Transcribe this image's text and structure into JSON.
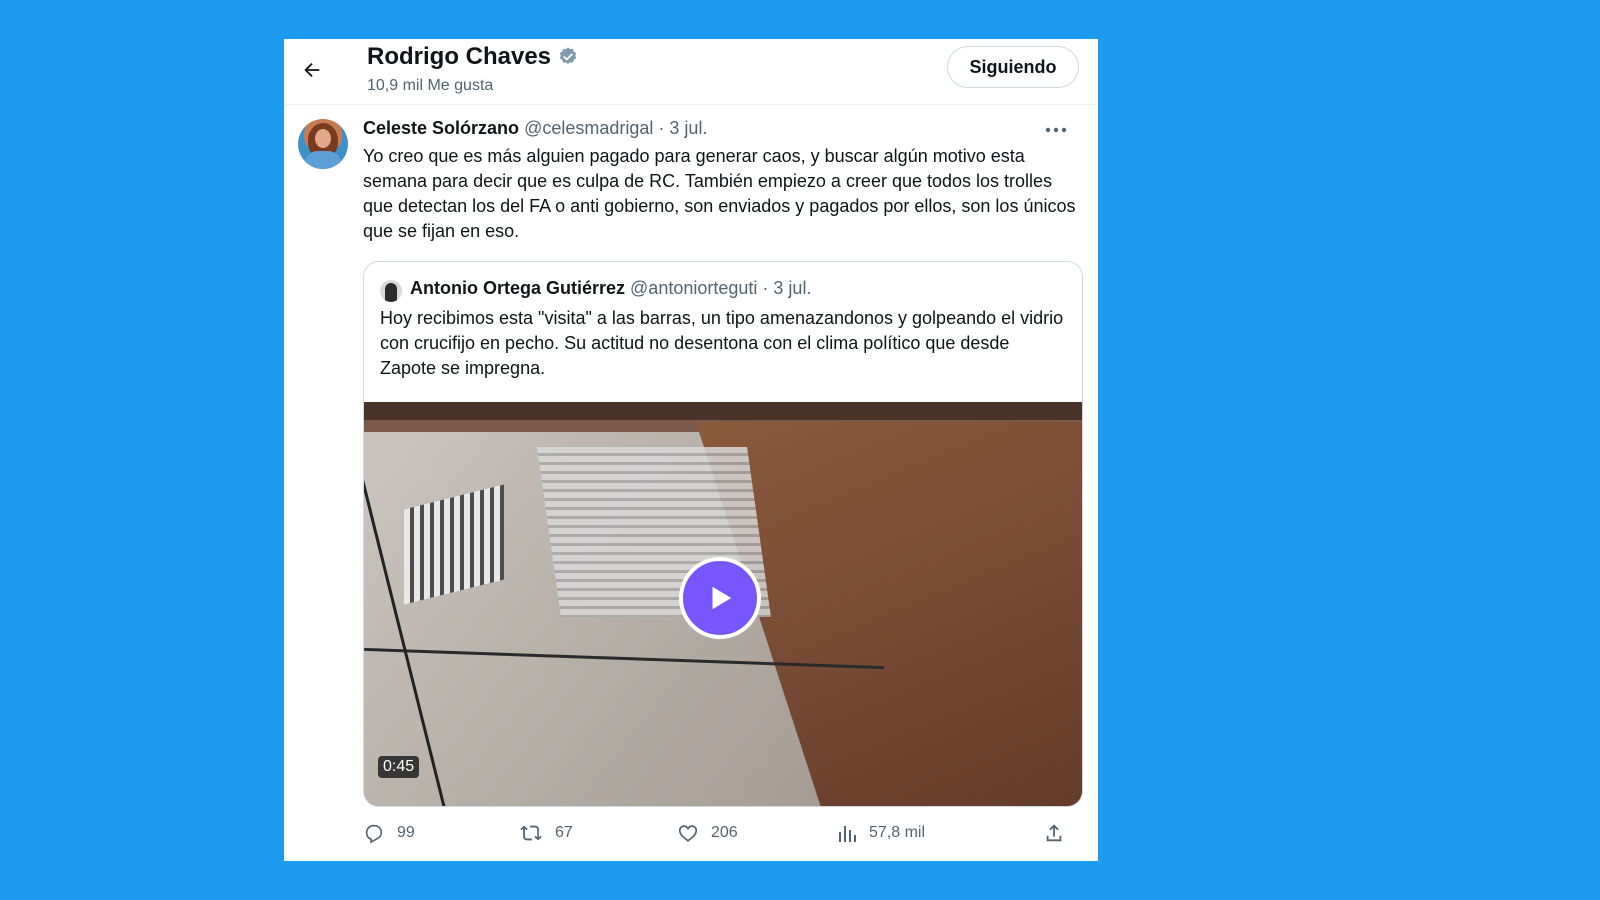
{
  "header": {
    "profile_name": "Rodrigo Chaves",
    "likes_count": "10,9 mil Me gusta",
    "follow_label": "Siguiendo"
  },
  "tweet": {
    "author_name": "Celeste Solórzano",
    "author_handle": "@celesmadrigal",
    "separator": "·",
    "date": "3 jul.",
    "text": "Yo creo que es más alguien pagado para generar caos, y buscar algún motivo esta semana para decir que es culpa de RC. También empiezo a creer que todos los trolles que detectan los del FA o anti gobierno, son enviados y pagados por ellos, son los únicos que se fijan en eso."
  },
  "quoted_tweet": {
    "author_name": "Antonio Ortega Gutiérrez",
    "author_handle": "@antoniorteguti",
    "separator": "·",
    "date": "3 jul.",
    "text": "Hoy recibimos esta \"visita\" a las barras, un tipo amenazandonos y golpeando el vidrio con crucifijo en pecho.  Su actitud no desentona con el clima político que desde Zapote se impregna.",
    "video_duration": "0:45"
  },
  "actions": {
    "replies": "99",
    "retweets": "67",
    "likes": "206",
    "views": "57,8 mil"
  },
  "colors": {
    "background": "#1d9bf0",
    "card": "#ffffff",
    "text_primary": "#0f1419",
    "text_secondary": "#536471",
    "verified_badge": "#829aab",
    "play_button": "#7856ff"
  },
  "icons": [
    "back-arrow-icon",
    "verified-badge-icon",
    "more-options-icon",
    "play-icon",
    "reply-icon",
    "retweet-icon",
    "like-icon",
    "views-icon",
    "share-icon"
  ]
}
